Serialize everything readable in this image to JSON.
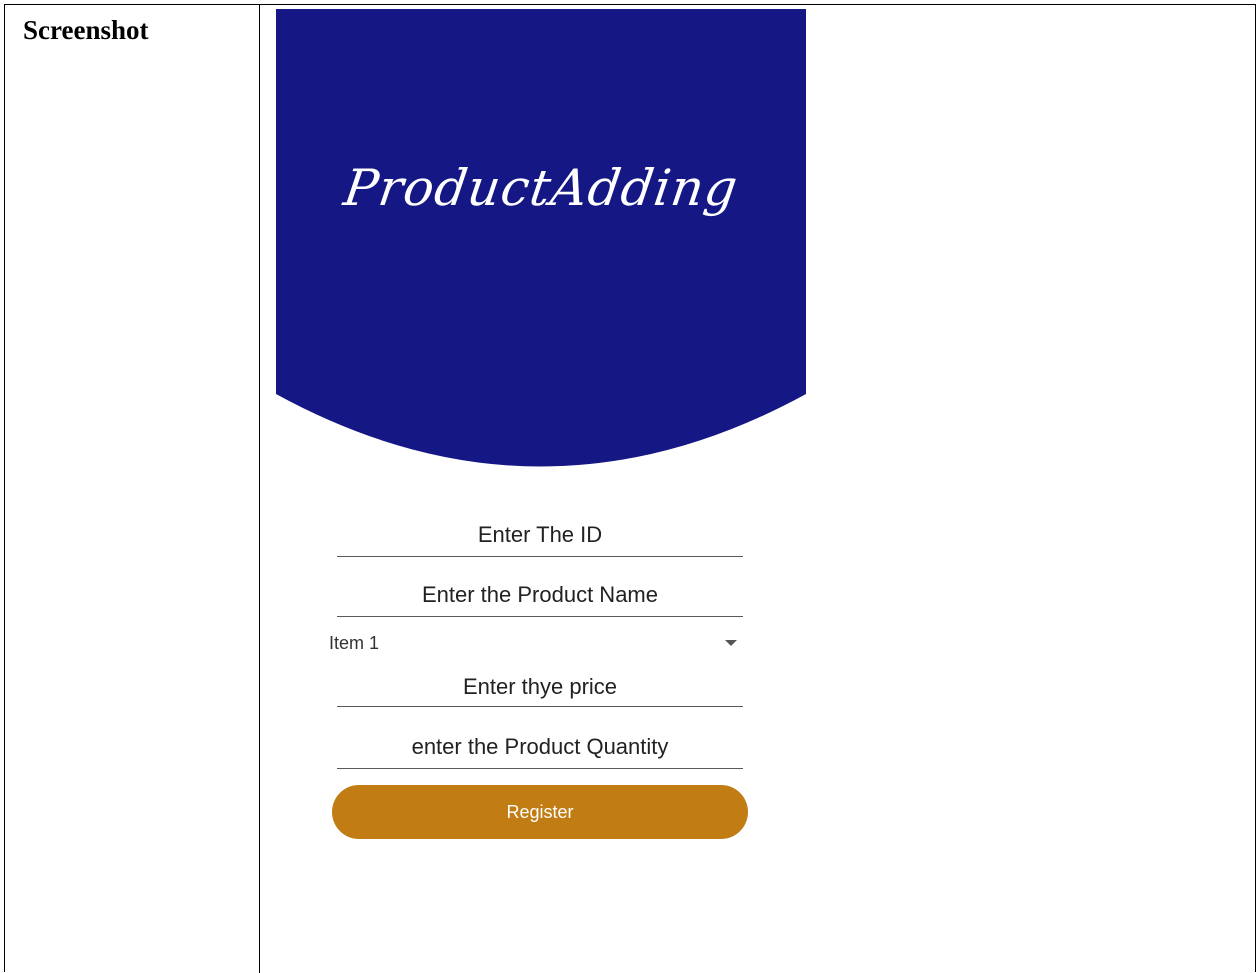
{
  "document": {
    "row_label": "Screenshot"
  },
  "app": {
    "title": "ProductAdding",
    "header_color": "#141784",
    "accent_color": "#c17d13"
  },
  "form": {
    "id_placeholder": "Enter The ID",
    "name_placeholder": "Enter the Product Name",
    "category_selected": "Item 1",
    "price_placeholder": "Enter thye price",
    "quantity_placeholder": "enter the Product Quantity",
    "register_label": "Register"
  },
  "icons": {
    "dropdown": "chevron-down-icon"
  }
}
